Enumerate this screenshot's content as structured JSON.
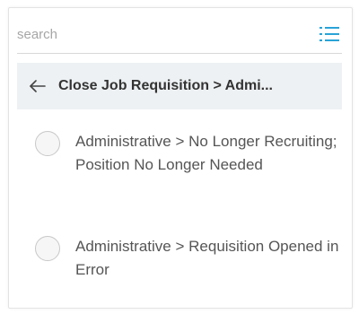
{
  "search": {
    "placeholder": "search",
    "value": ""
  },
  "icons": {
    "menu": "list-icon",
    "back": "back-arrow-icon",
    "radio": "radio-unchecked"
  },
  "colors": {
    "accent": "#29a3d8",
    "header_bg": "#eef1f3",
    "text": "#333333",
    "option_text": "#555555"
  },
  "header": {
    "title": "Close Job Requisition > Admi..."
  },
  "options": [
    {
      "label": "Administrative > No Longer Recruiting; Position No Longer Needed",
      "selected": false
    },
    {
      "label": "Administrative > Requisition Opened in Error",
      "selected": false
    }
  ]
}
